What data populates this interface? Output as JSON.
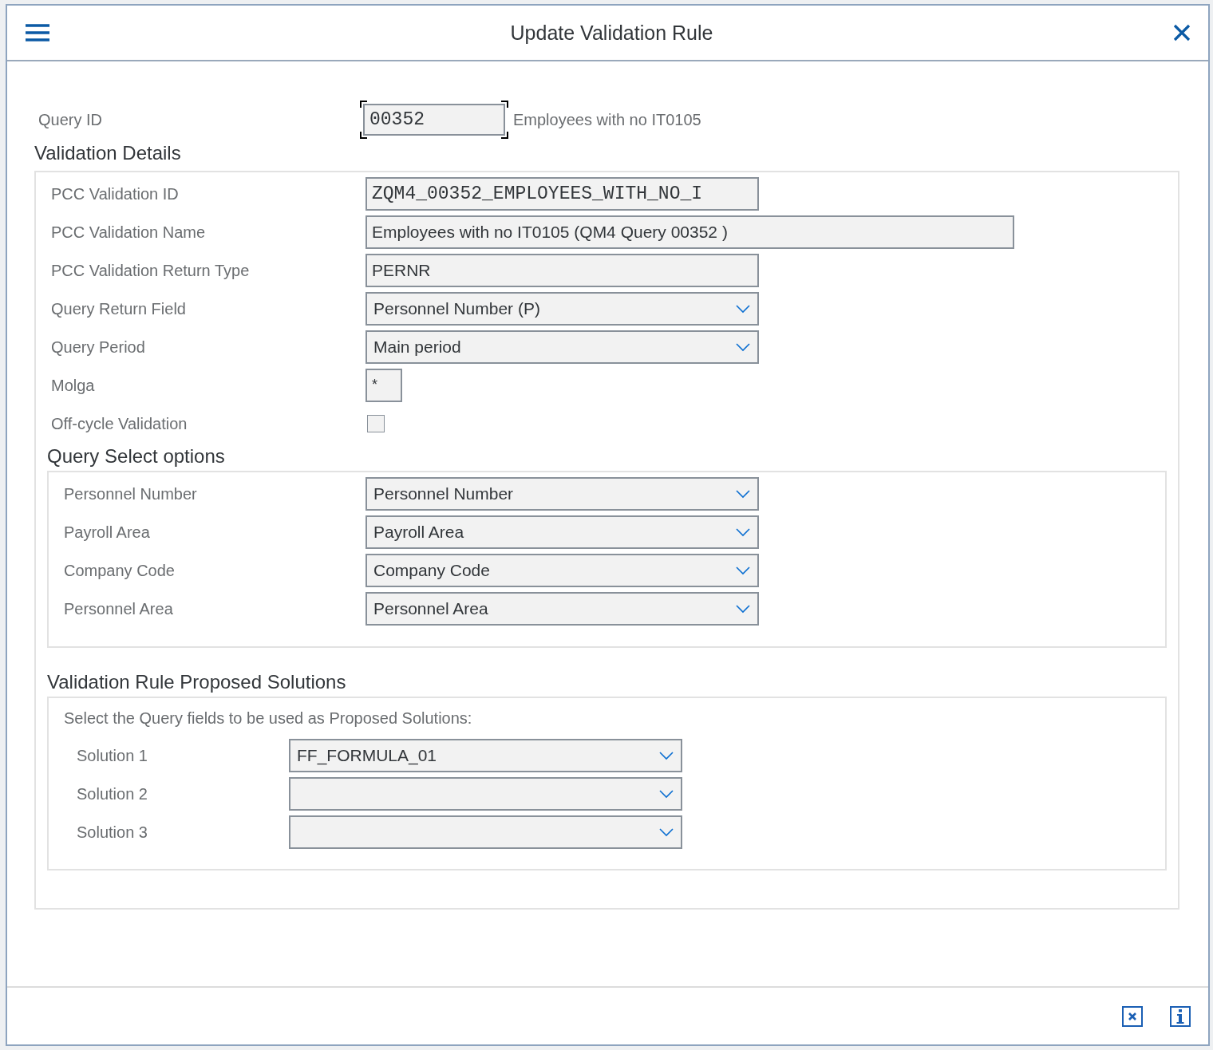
{
  "window": {
    "title": "Update Validation Rule"
  },
  "query": {
    "label": "Query ID",
    "value": "00352",
    "description": "Employees with no IT0105",
    "focused": true
  },
  "validation_details": {
    "title": "Validation Details",
    "fields": [
      {
        "kind": "code",
        "label": "PCC Validation ID",
        "value": "ZQM4_00352_EMPLOYEES_WITH_NO_I"
      },
      {
        "kind": "wide",
        "label": "PCC Validation Name",
        "value": "Employees with no IT0105 (QM4 Query 00352 )"
      },
      {
        "kind": "text",
        "label": "PCC Validation Return Type",
        "value": "PERNR"
      },
      {
        "kind": "select",
        "label": "Query Return Field",
        "value": "Personnel Number (P)"
      },
      {
        "kind": "select",
        "label": "Query Period",
        "value": "Main period"
      },
      {
        "kind": "short",
        "label": "Molga",
        "value": "*"
      },
      {
        "kind": "checkbox",
        "label": "Off-cycle Validation",
        "checked": false
      }
    ]
  },
  "query_select_options": {
    "title": "Query Select options",
    "fields": [
      {
        "kind": "select",
        "label": "Personnel Number",
        "value": "Personnel Number"
      },
      {
        "kind": "select",
        "label": "Payroll Area",
        "value": "Payroll Area"
      },
      {
        "kind": "select",
        "label": "Company Code",
        "value": "Company Code"
      },
      {
        "kind": "select",
        "label": "Personnel Area",
        "value": "Personnel Area"
      }
    ]
  },
  "proposed_solutions": {
    "title": "Validation Rule Proposed Solutions",
    "instruction": "Select the Query fields to be used as Proposed Solutions:",
    "fields": [
      {
        "kind": "select",
        "label": "Solution 1",
        "value": "FF_FORMULA_01"
      },
      {
        "kind": "select",
        "label": "Solution 2"
      },
      {
        "kind": "select",
        "label": "Solution 3"
      }
    ]
  }
}
